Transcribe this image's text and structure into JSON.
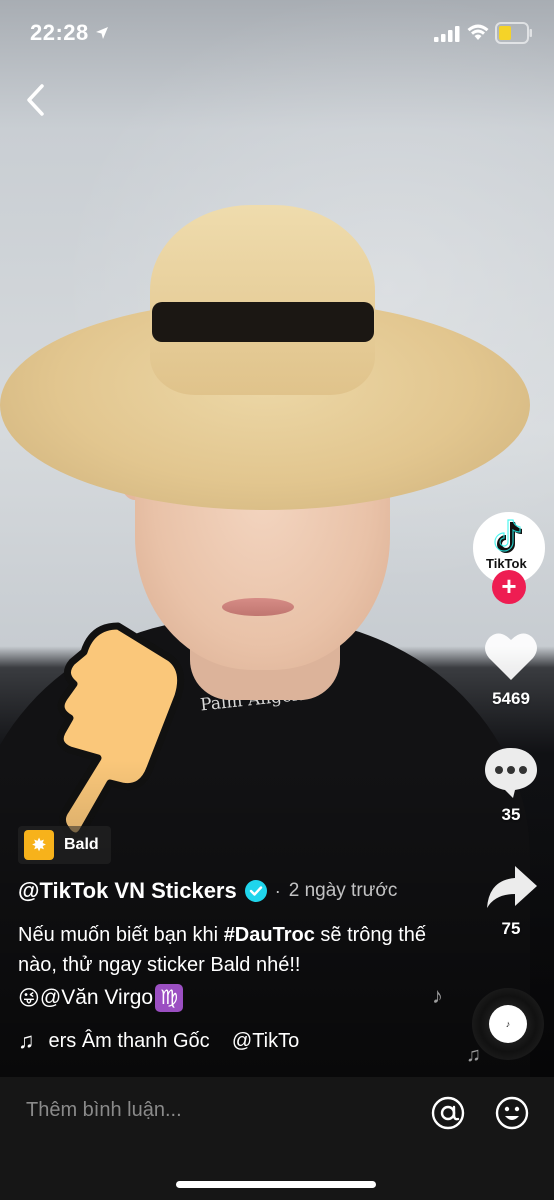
{
  "status_bar": {
    "time": "22:28"
  },
  "creator": {
    "avatar_label": "TikTok"
  },
  "actions": {
    "likes": "5469",
    "comments": "35",
    "shares": "75"
  },
  "video": {
    "collar_text": "Palm Angels"
  },
  "sticker": {
    "label": "Bald"
  },
  "post": {
    "author": "@TikTok VN Stickers",
    "separator": "·",
    "posted": "2 ngày trước",
    "caption_prefix": "Nếu muốn biết bạn khi ",
    "hashtag": "#DauTroc",
    "caption_suffix": " sẽ trông thế nào, thử ngay sticker Bald nhé!!",
    "mention_emoji": "😜",
    "mention": "@Văn Virgo",
    "mention_badge": "♍"
  },
  "music": {
    "text": "ers Âm thanh Gốc    @TikTo"
  },
  "comment_bar": {
    "placeholder": "Thêm bình luận..."
  },
  "colors": {
    "accent": "#ee1d52",
    "verified": "#20d5ec",
    "sticker_tag": "#f7b21b"
  }
}
